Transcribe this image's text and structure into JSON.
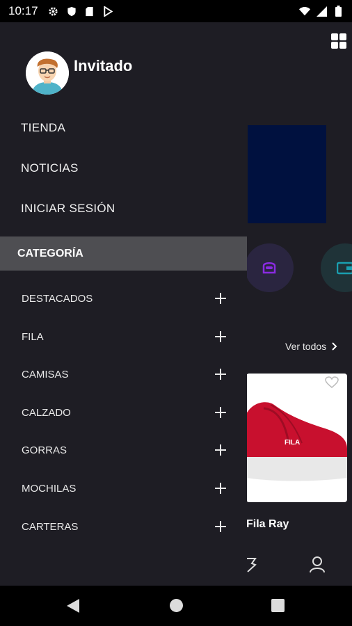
{
  "status_bar": {
    "time": "10:17",
    "left_icons": [
      "gear-icon",
      "shield-icon",
      "sd-card-icon",
      "play-store-icon"
    ],
    "right_icons": [
      "wifi-icon",
      "signal-icon",
      "battery-icon"
    ]
  },
  "drawer": {
    "user_name": "Invitado",
    "links": [
      "TIENDA",
      "NOTICIAS",
      "INICIAR SESIÓN"
    ],
    "category_header": "CATEGORÍA",
    "categories": [
      "DESTACADOS",
      "FILA",
      "CAMISAS",
      "CALZADO",
      "GORRAS",
      "MOCHILAS",
      "CARTERAS"
    ]
  },
  "background": {
    "see_all": "Ver todos",
    "product_name": "Fila Ray",
    "banner_color": "#00113f",
    "category_icons": [
      "mask-icon",
      "wallet-icon"
    ]
  },
  "colors": {
    "background": "#1e1d24",
    "category_header_bg": "#4e4e52",
    "product_red": "#c8102e"
  }
}
